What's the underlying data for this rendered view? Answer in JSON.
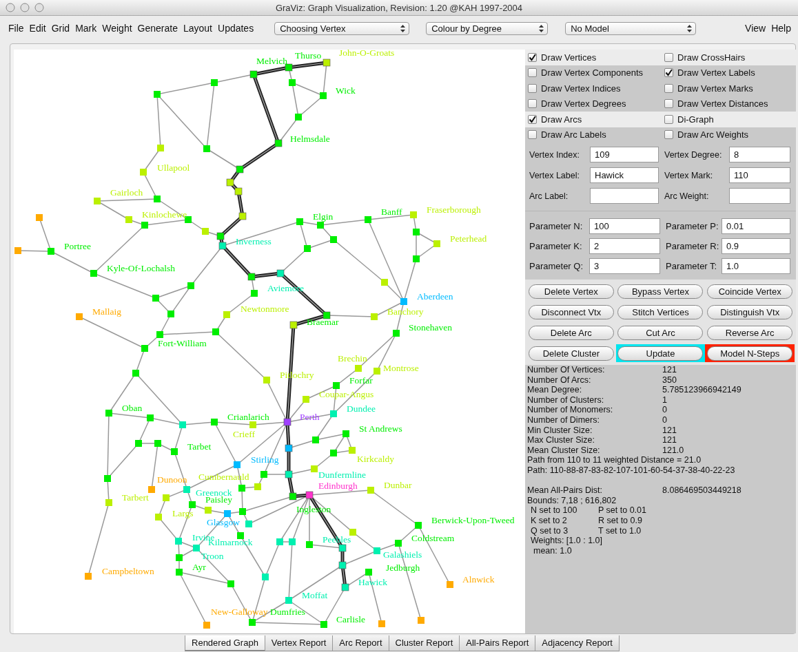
{
  "window": {
    "title": "GraViz: Graph Visualization, Revision: 1.20  @KAH 1997-2004"
  },
  "menu": [
    "File",
    "Edit",
    "Grid",
    "Mark",
    "Weight",
    "Generate",
    "Layout",
    "Updates"
  ],
  "selectors": [
    {
      "value": "Choosing Vertex"
    },
    {
      "value": "Colour by Degree"
    },
    {
      "value": "No Model"
    }
  ],
  "menu_right": [
    "View",
    "Help"
  ],
  "graph": {
    "vertices": [
      {
        "label": "John-O-Groats",
        "color": "#bbf000",
        "on_path": true
      },
      {
        "label": "Thurso",
        "color": "#00ee00",
        "on_path": true
      },
      {
        "label": "Melvich",
        "color": "#00ee00",
        "on_path": true
      },
      {
        "color": "#00ee00",
        "on_path": false
      },
      {
        "color": "#00ee00",
        "on_path": false
      },
      {
        "color": "#00ee00",
        "on_path": false
      },
      {
        "label": "Wick",
        "color": "#00ee00",
        "on_path": false
      },
      {
        "color": "#00ee00",
        "on_path": false
      },
      {
        "label": "Helmsdale",
        "color": "#00ee00",
        "on_path": true
      },
      {
        "color": "#bbf000",
        "on_path": false
      },
      {
        "color": "#00ee00",
        "on_path": false
      },
      {
        "color": "#00ee00",
        "on_path": true
      },
      {
        "label": "Ullapool",
        "color": "#bbf000",
        "on_path": false
      },
      {
        "color": "#bbf000",
        "on_path": true
      },
      {
        "color": "#bbf000",
        "on_path": true
      },
      {
        "color": "#00ee00",
        "on_path": false
      },
      {
        "label": "Gairloch",
        "color": "#bbf000",
        "on_path": false
      },
      {
        "label": "Fraserborough",
        "color": "#bbf000",
        "on_path": false
      },
      {
        "color": "#bbf000",
        "on_path": true
      },
      {
        "color": "#ffaa00",
        "on_path": false
      },
      {
        "label": "Kinlochewe",
        "color": "#bbf000",
        "on_path": false
      },
      {
        "color": "#00ee00",
        "on_path": false
      },
      {
        "label": "Banff",
        "color": "#00ee00",
        "on_path": false
      },
      {
        "color": "#00ee00",
        "on_path": false
      },
      {
        "color": "#00ee00",
        "on_path": false
      },
      {
        "label": "Elgin",
        "color": "#00ee00",
        "on_path": false
      },
      {
        "color": "#bbf000",
        "on_path": false
      },
      {
        "color": "#00ee00",
        "on_path": false
      },
      {
        "color": "#00ee00",
        "on_path": true
      },
      {
        "color": "#00ee00",
        "on_path": false
      },
      {
        "label": "Peterhead",
        "color": "#bbf000",
        "on_path": false
      },
      {
        "label": "Inverness",
        "color": "#00f0b0",
        "on_path": true
      },
      {
        "color": "#00ee00",
        "on_path": false
      },
      {
        "color": "#ffaa00",
        "on_path": false
      },
      {
        "label": "Portree",
        "color": "#00ee00",
        "on_path": false
      },
      {
        "color": "#00ee00",
        "on_path": false
      },
      {
        "label": "Kyle-Of-Lochalsh",
        "color": "#00ee00",
        "on_path": false
      },
      {
        "label": "Aviemore",
        "color": "#00f0b0",
        "on_path": true
      },
      {
        "color": "#00ee00",
        "on_path": true
      },
      {
        "color": "#bbf000",
        "on_path": false
      },
      {
        "color": "#00ee00",
        "on_path": false
      },
      {
        "color": "#00ee00",
        "on_path": false
      },
      {
        "color": "#00ee00",
        "on_path": false
      },
      {
        "label": "Aberdeen",
        "color": "#00bbff",
        "on_path": false
      },
      {
        "color": "#00ee00",
        "on_path": false
      },
      {
        "label": "Newtonmore",
        "color": "#bbf000",
        "on_path": false
      },
      {
        "label": "Braemar",
        "color": "#00ee00",
        "on_path": true
      },
      {
        "label": "Mallaig",
        "color": "#ffaa00",
        "on_path": false
      },
      {
        "label": "Banchory",
        "color": "#bbf000",
        "on_path": false
      },
      {
        "color": "#bbf000",
        "on_path": true
      },
      {
        "color": "#00ee00",
        "on_path": false
      },
      {
        "label": "Stonehaven",
        "color": "#00ee00",
        "on_path": false
      },
      {
        "label": "Fort-William",
        "color": "#00ee00",
        "on_path": false
      },
      {
        "color": "#00ee00",
        "on_path": false
      },
      {
        "label": "Brechin",
        "color": "#bbf000",
        "on_path": false
      },
      {
        "label": "Montrose",
        "color": "#bbf000",
        "on_path": false
      },
      {
        "color": "#00ee00",
        "on_path": false
      },
      {
        "label": "Pitlochry",
        "color": "#bbf000",
        "on_path": false
      },
      {
        "label": "Forfar",
        "color": "#00ee00",
        "on_path": false
      },
      {
        "label": "Coupar-Angus",
        "color": "#bbf000",
        "on_path": false
      },
      {
        "label": "Oban",
        "color": "#00ee00",
        "on_path": false
      },
      {
        "label": "Dundee",
        "color": "#00f0b0",
        "on_path": false
      },
      {
        "color": "#00ee00",
        "on_path": false
      },
      {
        "label": "Crianlarich",
        "color": "#00ee00",
        "on_path": false
      },
      {
        "label": "Perth",
        "color": "#a040ff",
        "on_path": true
      },
      {
        "color": "#00f0b0",
        "on_path": false
      },
      {
        "label": "Crieff",
        "color": "#bbf000",
        "on_path": false
      },
      {
        "label": "St Andrews",
        "color": "#00ee00",
        "on_path": false
      },
      {
        "color": "#00ee00",
        "on_path": false
      },
      {
        "color": "#00ee00",
        "on_path": false
      },
      {
        "color": "#00ee00",
        "on_path": false
      },
      {
        "color": "#00bbff",
        "on_path": true
      },
      {
        "label": "Kirkcaldy",
        "color": "#bbf000",
        "on_path": false
      },
      {
        "label": "Tarbet",
        "color": "#00ee00",
        "on_path": false
      },
      {
        "color": "#00ee00",
        "on_path": false
      },
      {
        "label": "Stirling",
        "color": "#00bbff",
        "on_path": false
      },
      {
        "color": "#bbf000",
        "on_path": false
      },
      {
        "color": "#00ee00",
        "on_path": false
      },
      {
        "label": "Dunfermline",
        "color": "#00f0b0",
        "on_path": true
      },
      {
        "color": "#00ee00",
        "on_path": false
      },
      {
        "label": "Cumbernauld",
        "color": "#bbf000",
        "on_path": false
      },
      {
        "color": "#00ee00",
        "on_path": false
      },
      {
        "label": "Dunoon",
        "color": "#ffaa00",
        "on_path": false
      },
      {
        "label": "Greenock",
        "color": "#00f0b0",
        "on_path": false
      },
      {
        "label": "Dunbar",
        "color": "#bbf000",
        "on_path": false
      },
      {
        "label": "Edinburgh",
        "color": "#ff33cc",
        "on_path": true
      },
      {
        "label": "Ingleston",
        "color": "#00ee00",
        "on_path": true
      },
      {
        "color": "#bbf000",
        "on_path": false
      },
      {
        "label": "Tarbert",
        "color": "#bbf000",
        "on_path": false
      },
      {
        "label": "Paisley",
        "color": "#00ee00",
        "on_path": false
      },
      {
        "color": "#bbf000",
        "on_path": false
      },
      {
        "color": "#00ee00",
        "on_path": false
      },
      {
        "label": "Glasgow",
        "color": "#00bbff",
        "on_path": false
      },
      {
        "label": "Largs",
        "color": "#bbf000",
        "on_path": false
      },
      {
        "label": "Kilmarnock",
        "color": "#00f0b0",
        "on_path": false
      },
      {
        "label": "Berwick-Upon-Tweed",
        "color": "#00ee00",
        "on_path": false
      },
      {
        "color": "#bbf000",
        "on_path": false
      },
      {
        "color": "#00ee00",
        "on_path": false
      },
      {
        "label": "Irvine",
        "color": "#00f0b0",
        "on_path": false
      },
      {
        "color": "#00f0b0",
        "on_path": false
      },
      {
        "color": "#00f0b0",
        "on_path": false
      },
      {
        "label": "Coldstream",
        "color": "#00ee00",
        "on_path": false
      },
      {
        "color": "#00ee00",
        "on_path": false
      },
      {
        "label": "Troon",
        "color": "#00f0b0",
        "on_path": false
      },
      {
        "label": "Peebles",
        "color": "#00f0b0",
        "on_path": true
      },
      {
        "label": "Galashiels",
        "color": "#00f0b0",
        "on_path": false
      },
      {
        "color": "#00ee00",
        "on_path": false
      },
      {
        "color": "#00f0b0",
        "on_path": true
      },
      {
        "label": "Ayr",
        "color": "#00ee00",
        "on_path": false
      },
      {
        "label": "Jedburgh",
        "color": "#00ee00",
        "on_path": false
      },
      {
        "label": "Campbeltown",
        "color": "#ffaa00",
        "on_path": false
      },
      {
        "color": "#00f0b0",
        "on_path": false
      },
      {
        "color": "#00ee00",
        "on_path": false
      },
      {
        "label": "Alnwick",
        "color": "#ffaa00",
        "on_path": false
      },
      {
        "label": "Hawick",
        "color": "#00f0b0",
        "on_path": true
      },
      {
        "label": "Moffat",
        "color": "#00f0b0",
        "on_path": false
      },
      {
        "color": "#ffaa00",
        "on_path": false
      },
      {
        "label": "Dumfries",
        "color": "#00ee00",
        "on_path": false
      },
      {
        "color": "#ffaa00",
        "on_path": false
      },
      {
        "label": "Carlisle",
        "color": "#00ee00",
        "on_path": false
      },
      {
        "label": "New-Galloway",
        "color": "#ffaa00",
        "on_path": false
      }
    ]
  },
  "options": [
    {
      "label": "Draw Vertices",
      "checked": true
    },
    {
      "label": "Draw CrossHairs",
      "checked": false
    },
    {
      "label": "Draw Vertex Components",
      "checked": false
    },
    {
      "label": "Draw Vertex Labels",
      "checked": true
    },
    {
      "label": "Draw Vertex Indices",
      "checked": false
    },
    {
      "label": "Draw Vertex Marks",
      "checked": false
    },
    {
      "label": "Draw Vertex Degrees",
      "checked": false
    },
    {
      "label": "Draw Vertex Distances",
      "checked": false
    },
    {
      "label": "Draw Arcs",
      "checked": true
    },
    {
      "label": "Di-Graph",
      "checked": false
    },
    {
      "label": "Draw Arc Labels",
      "checked": false
    },
    {
      "label": "Draw Arc Weights",
      "checked": false
    }
  ],
  "fields": [
    {
      "label": "Vertex Index:",
      "value": "109"
    },
    {
      "label": "Vertex Degree:",
      "value": "8"
    },
    {
      "label": "Vertex Label:",
      "value": "Hawick"
    },
    {
      "label": "Vertex Mark:",
      "value": "110"
    },
    {
      "label": "Arc Label:"
    },
    {
      "label": "Arc Weight:"
    }
  ],
  "parameters": [
    {
      "label": "Parameter N:",
      "value": "100"
    },
    {
      "label": "Parameter P:",
      "value": "0.01"
    },
    {
      "label": "Parameter K:",
      "value": "2"
    },
    {
      "label": "Parameter R:",
      "value": "0.9"
    },
    {
      "label": "Parameter Q:",
      "value": "3"
    },
    {
      "label": "Parameter T:",
      "value": "1.0"
    }
  ],
  "buttons": [
    {
      "label": "Delete Vertex"
    },
    {
      "label": "Bypass Vertex"
    },
    {
      "label": "Coincide Vertex"
    },
    {
      "label": "Disconnect Vtx"
    },
    {
      "label": "Stitch Vertices"
    },
    {
      "label": "Distinguish Vtx"
    },
    {
      "label": "Delete Arc"
    },
    {
      "label": "Cut Arc"
    },
    {
      "label": "Reverse Arc"
    },
    {
      "label": "Delete Cluster"
    },
    {
      "label": "Update",
      "color": "#00e5ee"
    },
    {
      "label": "Model N-Steps",
      "color": "#ff2200"
    }
  ],
  "stats": [
    {
      "label": "Number Of Vertices:",
      "value": "121"
    },
    {
      "label": "Number Of Arcs:",
      "value": "350"
    },
    {
      "label": "Mean Degree:",
      "value": "5.785123966942149"
    },
    {
      "label": "Number of Clusters:",
      "value": "1"
    },
    {
      "label": "Number of Monomers:",
      "value": "0"
    },
    {
      "label": "Number of  Dimers:",
      "value": "0"
    },
    {
      "label": "Min Cluster Size:",
      "value": "121"
    },
    {
      "label": "Max Cluster Size:",
      "value": "121"
    },
    {
      "label": "Mean Cluster Size:",
      "value": "121.0"
    }
  ],
  "path_info": [
    "Path from 110 to 11 weighted Distance = 21.0",
    "Path: 110-88-87-83-82-107-101-60-54-37-38-40-22-23"
  ],
  "mean_dist": {
    "label": "Mean All-Pairs Dist:",
    "value": "8.086469503449218"
  },
  "bounds": "Bounds: 7,18 ; 616,802",
  "settings": [
    {
      "left": "N set to 100",
      "right": "P set to 0.01"
    },
    {
      "left": "K set to 2",
      "right": "R set to 0.9"
    },
    {
      "left": "Q set to 3",
      "right": "T set to 1.0"
    }
  ],
  "weights": "Weights: [1.0 : 1.0]",
  "mean": "mean: 1.0",
  "tabs": [
    {
      "label": "Rendered Graph",
      "selected": true
    },
    {
      "label": "Vertex Report",
      "selected": false
    },
    {
      "label": "Arc Report",
      "selected": false
    },
    {
      "label": "Cluster Report",
      "selected": false
    },
    {
      "label": "All-Pairs Report",
      "selected": false
    },
    {
      "label": "Adjacency Report",
      "selected": false
    }
  ]
}
